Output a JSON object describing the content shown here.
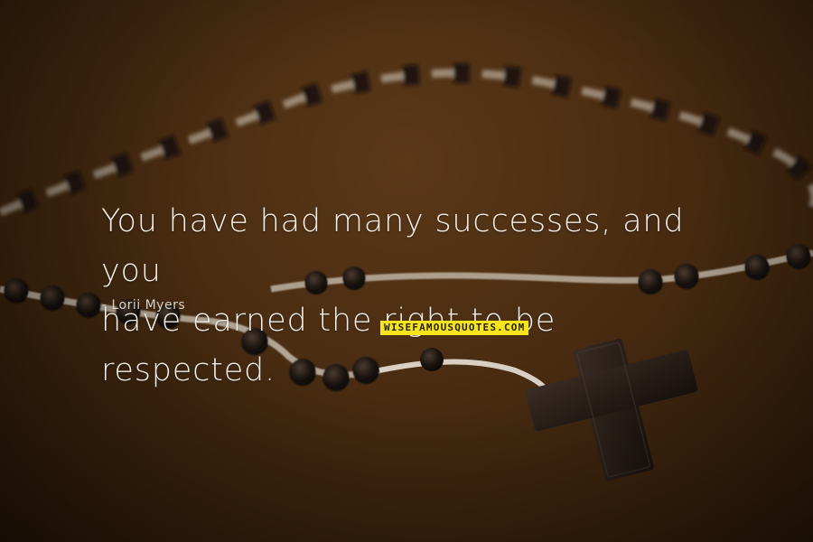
{
  "quote": {
    "line1": "You have had many successes, and you",
    "line2": "have earned the right to be respected."
  },
  "author": {
    "dash_name": "- Lorii Myers"
  },
  "watermark": {
    "text": "WISEFAMOUSQUOTES.COM"
  },
  "colors": {
    "background": "#4a2d12",
    "quote_text": "#f1ede6",
    "watermark_bg": "#f6e51c"
  },
  "photo": {
    "subject": "rosary-beads-with-cross"
  }
}
